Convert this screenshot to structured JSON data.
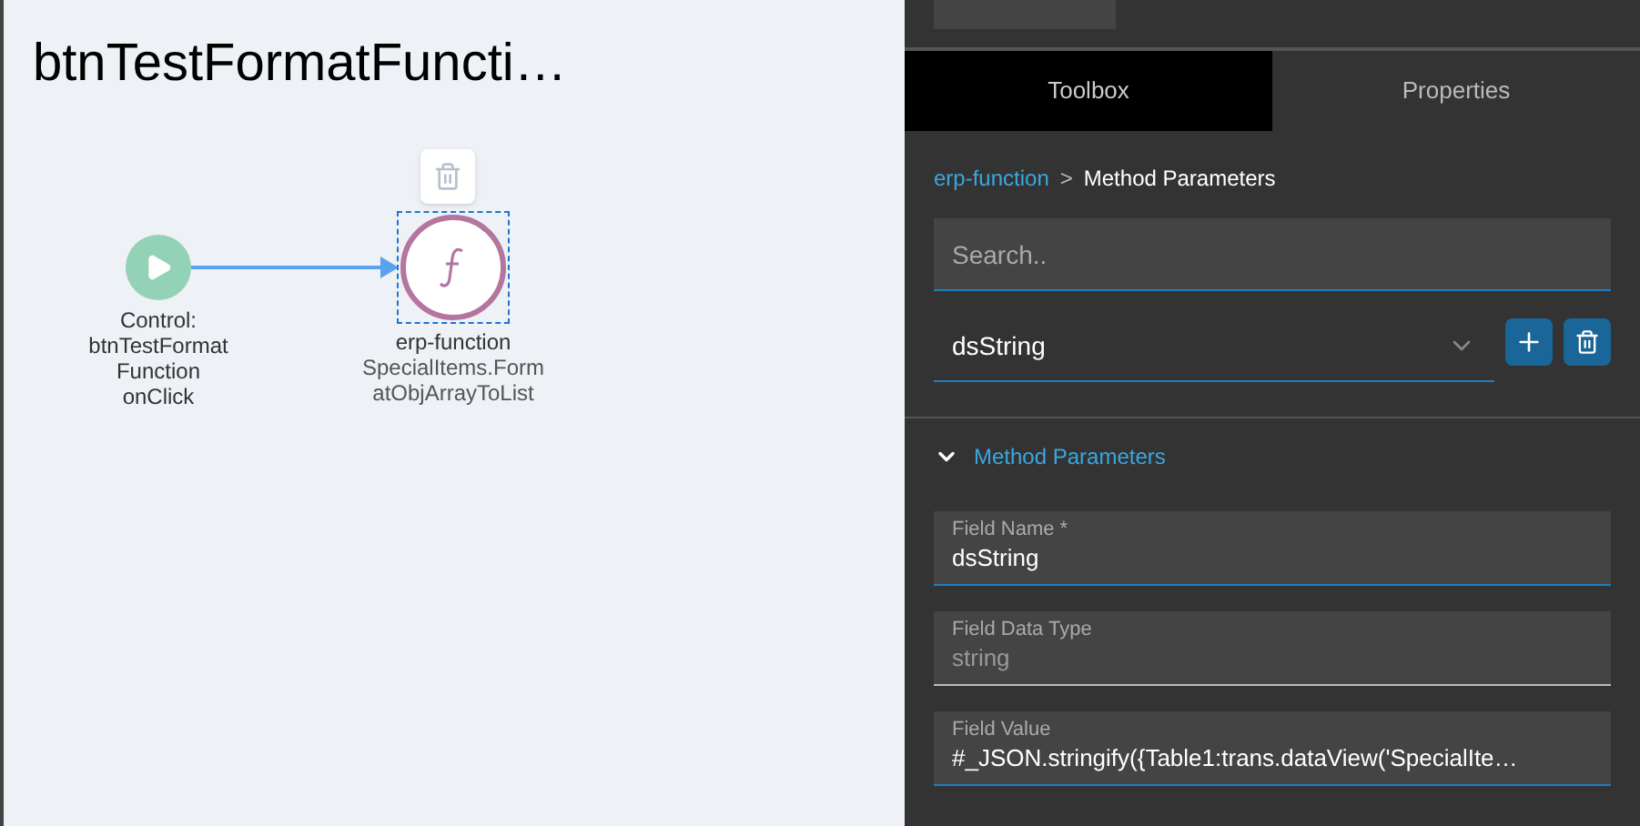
{
  "canvas": {
    "title": "btnTestFormatFuncti…",
    "nodes": [
      {
        "kind": "start",
        "lines": [
          "Control:",
          "btnTestFormat",
          "Function",
          "onClick"
        ],
        "selected": false
      },
      {
        "kind": "function",
        "lines": [
          "erp-function",
          "SpecialItems.Form",
          "atObjArrayToList"
        ],
        "selected": true
      }
    ]
  },
  "panel": {
    "tabs": [
      {
        "label": "Toolbox",
        "selected": true
      },
      {
        "label": "Properties",
        "selected": false
      }
    ],
    "breadcrumb": {
      "link": "erp-function",
      "separator": ">",
      "current": "Method Parameters"
    },
    "search": {
      "placeholder": "Search.."
    },
    "select": {
      "value": "dsString"
    },
    "section": {
      "title": "Method Parameters",
      "expanded": true
    },
    "fields": [
      {
        "label": "Field Name *",
        "value": "dsString",
        "disabled": false
      },
      {
        "label": "Field Data Type",
        "value": "string",
        "disabled": true
      },
      {
        "label": "Field Value",
        "value": "#_JSON.stringify({Table1:trans.dataView('SpecialIte…",
        "disabled": false
      }
    ]
  }
}
